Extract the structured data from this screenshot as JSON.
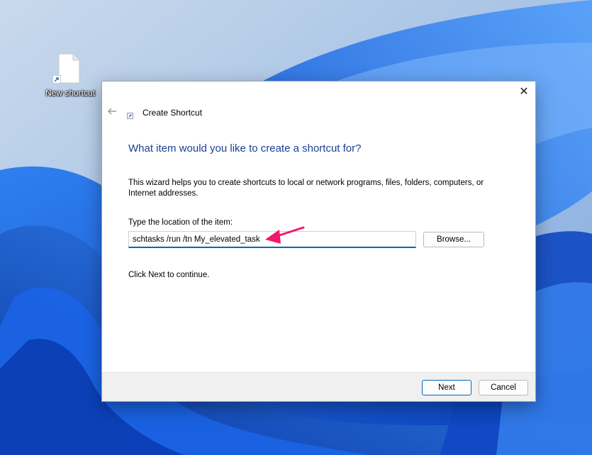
{
  "desktop": {
    "shortcut_label": "New shortcut"
  },
  "dialog": {
    "title": "Create Shortcut",
    "close_glyph": "✕",
    "heading": "What item would you like to create a shortcut for?",
    "description": "This wizard helps you to create shortcuts to local or network programs, files, folders, computers, or Internet addresses.",
    "location_label": "Type the location of the item:",
    "location_value": "schtasks /run /tn My_elevated_task",
    "browse_label": "Browse...",
    "hint": "Click Next to continue.",
    "next_label": "Next",
    "cancel_label": "Cancel"
  },
  "icons": {
    "back": "back-arrow-icon",
    "close": "close-icon",
    "shortcut": "shortcut-icon",
    "file": "file-icon",
    "annotation": "pink-arrow-annotation"
  },
  "colors": {
    "heading": "#1c3f94",
    "input_focus": "#0067c0",
    "annotation": "#f0186e",
    "wallpaper_blue": "#1f6fe0"
  }
}
